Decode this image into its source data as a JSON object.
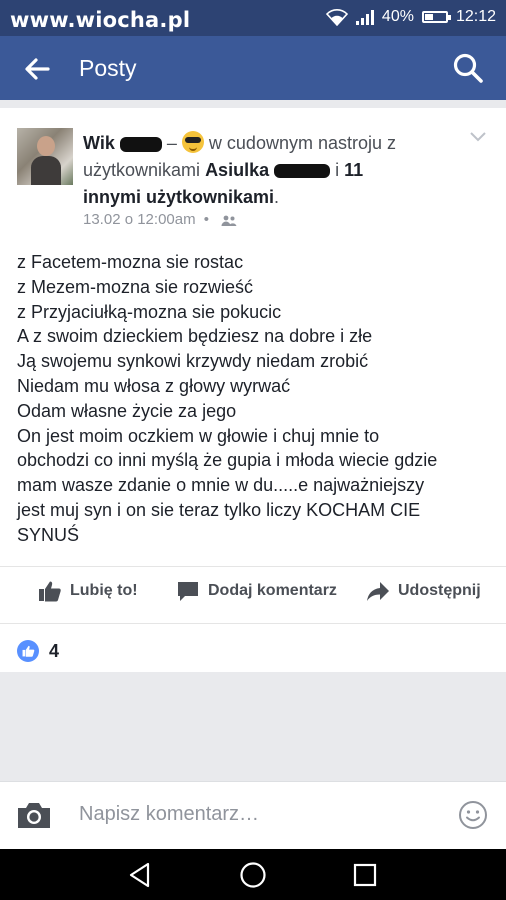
{
  "status_bar": {
    "watermark": "www.wiocha.pl",
    "battery": "40%",
    "battery_level": 0.4,
    "time": "12:12"
  },
  "app_bar": {
    "title": "Posty",
    "back_icon": "arrow-back-icon",
    "search_icon": "search-icon"
  },
  "post": {
    "author": "Wik",
    "dash": "–",
    "feeling": "w cudownym nastroju z",
    "with_prefix": "użytkownikami",
    "tagged": "Asiulka",
    "and": "i",
    "others": "11 innymi użytkownikami",
    "period": ".",
    "date": "13.02 o 12:00am",
    "sep": "•",
    "audience_icon": "friends-icon",
    "body_lines": [
      "z Facetem-mozna sie rostac",
      "z Mezem-mozna sie rozwieść",
      "z Przyjaciułką-mozna sie pokucic",
      "A z swoim dzieckiem będziesz na dobre i złe",
      "Ją swojemu synkowi krzywdy niedam zrobić",
      "Niedam mu włosa z głowy wyrwać",
      "Odam własne życie za jego",
      "On jest moim oczkiem w głowie i chuj mnie to",
      "obchodzi co inni myślą że gupia i młoda wiecie gdzie",
      "mam wasze zdanie o mnie w du.....e najważniejszy",
      "jest muj syn i on sie teraz tylko liczy KOCHAM CIE",
      "SYNUŚ"
    ]
  },
  "actions": {
    "like": "Lubię to!",
    "comment": "Dodaj komentarz",
    "share": "Udostępnij"
  },
  "reactions": {
    "count": "4"
  },
  "composer": {
    "placeholder": "Napisz komentarz…"
  },
  "colors": {
    "facebook_blue": "#3b5998",
    "status_bar": "#2d4373",
    "like_blue": "#5890ff"
  }
}
